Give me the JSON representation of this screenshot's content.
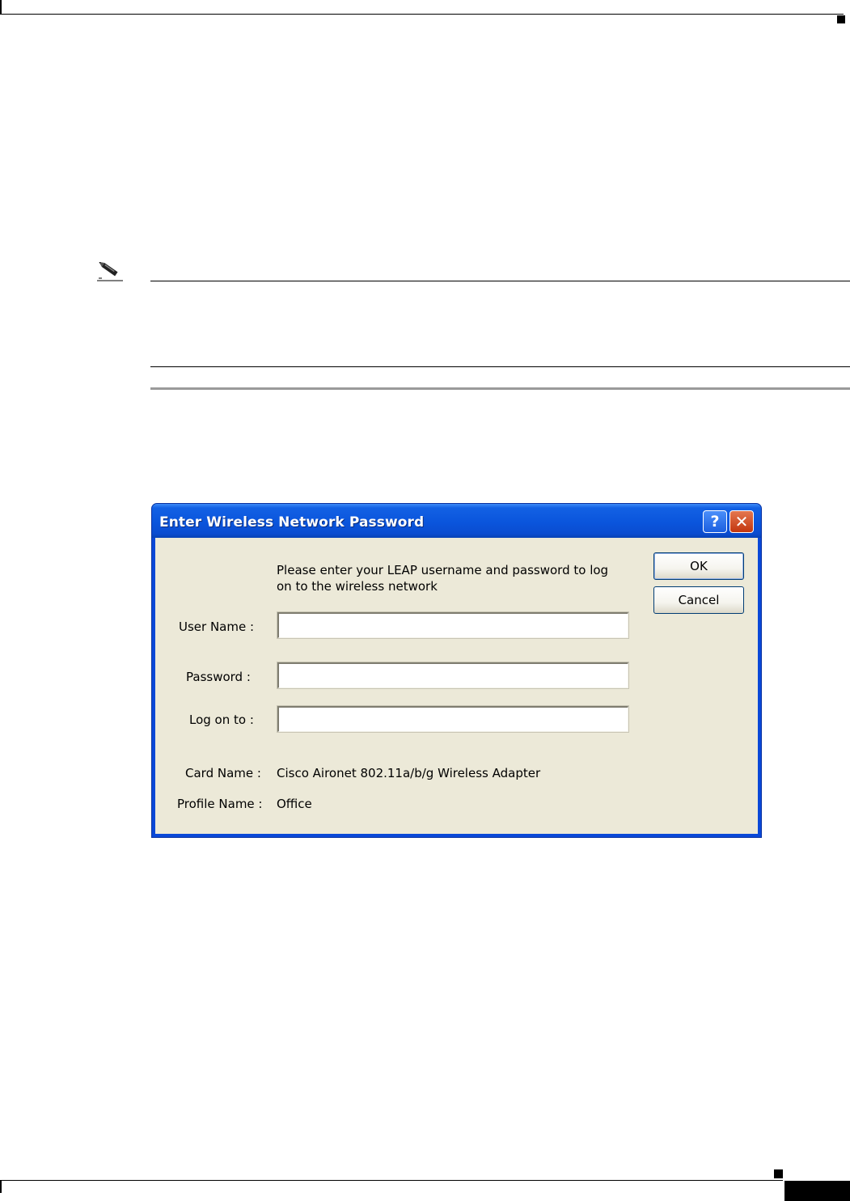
{
  "dialog": {
    "title": "Enter Wireless Network Password",
    "prompt": "Please enter your LEAP username and password to log on to the wireless network",
    "fields": {
      "username_label": "User Name :",
      "username_value": "",
      "password_label": "Password :",
      "password_value": "",
      "logon_label": "Log on to :",
      "logon_value": ""
    },
    "info": {
      "card_label": "Card Name :",
      "card_value": "Cisco Aironet 802.11a/b/g Wireless Adapter",
      "profile_label": "Profile Name :",
      "profile_value": "Office"
    },
    "buttons": {
      "ok": "OK",
      "cancel": "Cancel",
      "help": "?",
      "close": "✕"
    }
  },
  "icons": {
    "note": "pencil-note-icon"
  },
  "colors": {
    "titlebar": "#0a55dc",
    "client_bg": "#ece9d8",
    "close_button": "#c3360f"
  }
}
